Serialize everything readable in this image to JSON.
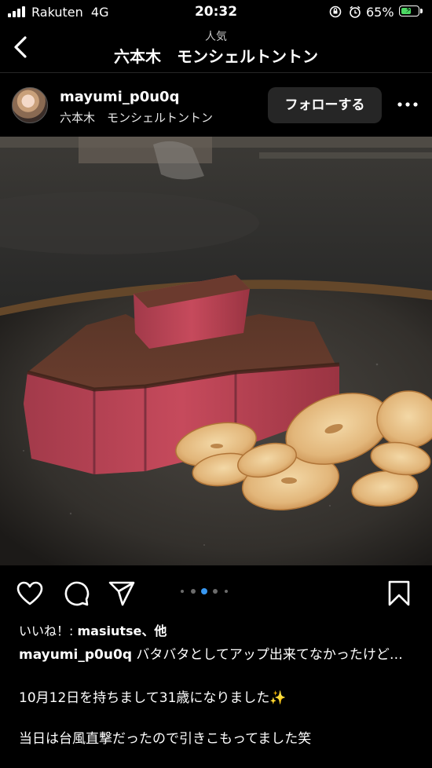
{
  "status_bar": {
    "carrier": "Rakuten",
    "network": "4G",
    "time": "20:32",
    "battery_percent": "65%",
    "battery_level": 0.65,
    "battery_color": "#4cd964"
  },
  "nav": {
    "subtitle": "人気",
    "title": "六本木　モンシェルトントン",
    "back_icon": "chevron-left-icon"
  },
  "post": {
    "username": "mayumi_p0u0q",
    "location": "六本木　モンシェルトントン",
    "follow_label": "フォローする",
    "more_icon": "ellipsis-icon",
    "carousel": {
      "count": 5,
      "active": 2,
      "active_color": "#3897f0"
    }
  },
  "likes": {
    "prefix": "いいね！: ",
    "user": "masiutse",
    "suffix": "、他"
  },
  "caption": {
    "username": "mayumi_p0u0q",
    "text": " バタバタとしてアップ出来てなかったけど…",
    "line3": "10月12日を持ちまして31歳になりました✨",
    "line4": "当日は台風直撃だったので引きこもってました笑"
  }
}
